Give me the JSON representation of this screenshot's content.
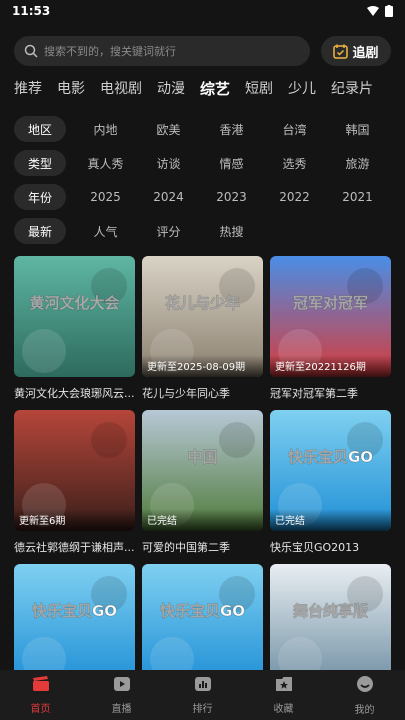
{
  "status_bar": {
    "time": "11:53"
  },
  "search": {
    "placeholder": "搜索不到的，搜关键词就行",
    "track_label": "追剧"
  },
  "category_tabs": [
    "推荐",
    "电影",
    "电视剧",
    "动漫",
    "综艺",
    "短剧",
    "少儿",
    "纪录片"
  ],
  "active_category": "综艺",
  "filters": [
    {
      "key": "地区",
      "options": [
        "内地",
        "欧美",
        "香港",
        "台湾",
        "韩国"
      ]
    },
    {
      "key": "类型",
      "options": [
        "真人秀",
        "访谈",
        "情感",
        "选秀",
        "旅游"
      ]
    },
    {
      "key": "年份",
      "options": [
        "2025",
        "2024",
        "2023",
        "2022",
        "2021"
      ]
    },
    {
      "key": "最新",
      "options": [
        "人气",
        "评分",
        "热搜"
      ]
    }
  ],
  "cards": [
    {
      "title": "黄河文化大会琅琊风云...",
      "badge": "",
      "poster_text": "黄河文化大会",
      "color_top": "#5fb6a3",
      "color_bottom": "#2d6b5e"
    },
    {
      "title": "花儿与少年同心季",
      "badge": "更新至2025-08-09期",
      "poster_text": "花儿与少年",
      "color_top": "#d9d3c6",
      "color_bottom": "#8a7f6e"
    },
    {
      "title": "冠军对冠军第二季",
      "badge": "更新至20221126期",
      "poster_text": "冠军对冠军",
      "color_top": "#4a8ee6",
      "color_bottom": "#d83b3b"
    },
    {
      "title": "德云社郭德纲于谦相声...",
      "badge": "更新至6期",
      "poster_text": "",
      "color_top": "#b6463a",
      "color_bottom": "#3a1f1a"
    },
    {
      "title": "可爱的中国第二季",
      "badge": "已完结",
      "poster_text": "中国",
      "color_top": "#b7c8d6",
      "color_bottom": "#4f7a3a"
    },
    {
      "title": "快乐宝贝GO2013",
      "badge": "已完结",
      "poster_text": "快乐宝贝GO",
      "color_top": "#7fd0f0",
      "color_bottom": "#1f8fd6"
    },
    {
      "title": "",
      "badge": "",
      "poster_text": "快乐宝贝GO",
      "color_top": "#7fd0f0",
      "color_bottom": "#1f8fd6"
    },
    {
      "title": "",
      "badge": "",
      "poster_text": "快乐宝贝GO",
      "color_top": "#7fd0f0",
      "color_bottom": "#1f8fd6"
    },
    {
      "title": "",
      "badge": "",
      "poster_text": "舞台纯享版",
      "color_top": "#e9eef2",
      "color_bottom": "#6f8fa3"
    }
  ],
  "bottom_nav": [
    {
      "label": "首页",
      "icon": "clapperboard-icon",
      "active": true
    },
    {
      "label": "直播",
      "icon": "play-icon",
      "active": false
    },
    {
      "label": "排行",
      "icon": "chart-icon",
      "active": false
    },
    {
      "label": "收藏",
      "icon": "star-folder-icon",
      "active": false
    },
    {
      "label": "我的",
      "icon": "smile-icon",
      "active": false
    }
  ],
  "colors": {
    "accent": "#e43a3a",
    "background": "#141414",
    "chip": "#2a2a2a"
  }
}
